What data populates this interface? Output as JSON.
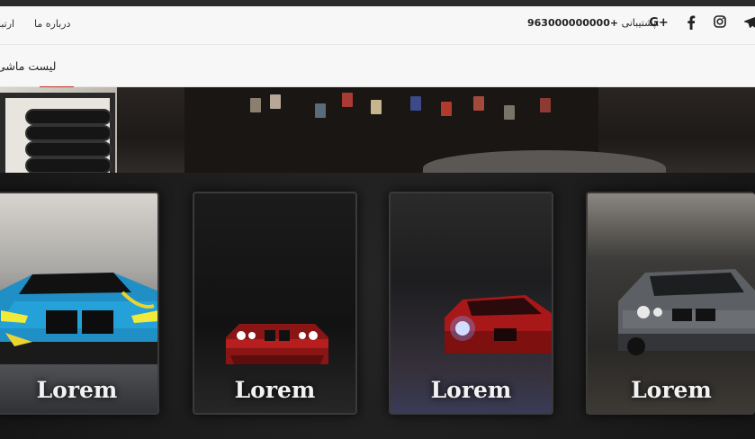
{
  "topbar": {
    "links": [
      "درباره ما",
      "ارتبا"
    ],
    "support_label": "پشتیبانی:",
    "support_number": "963000000000+",
    "social_icons": [
      "google-plus-icon",
      "facebook-icon",
      "instagram-icon",
      "telegram-icon"
    ],
    "google_plus_text": "G+"
  },
  "navbar": {
    "title": "لیست ماشی",
    "accent_color": "#c0392b"
  },
  "cards": [
    {
      "label": "Lorem",
      "image": "blue racing BMW M8 in garage"
    },
    {
      "label": "Lorem",
      "image": "red BMW front in dark"
    },
    {
      "label": "Lorem",
      "image": "red BMW in smoky garage"
    },
    {
      "label": "Lorem",
      "image": "grey BMW M3 in parking garage"
    }
  ]
}
